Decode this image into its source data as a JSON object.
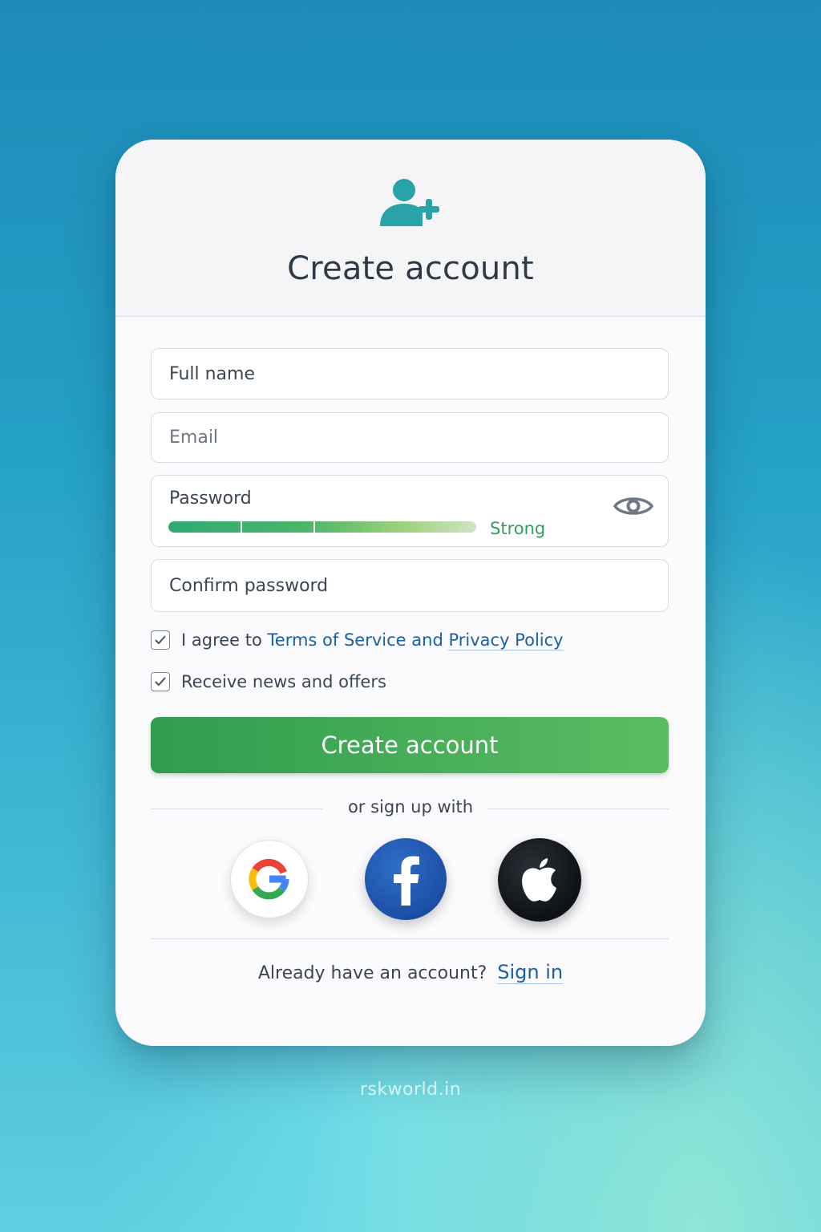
{
  "header": {
    "title": "Create account",
    "icon": "user-plus-icon"
  },
  "form": {
    "full_name_placeholder": "Full name",
    "email_placeholder": "Email",
    "password_placeholder": "Password",
    "password_strength": {
      "label": "Strong",
      "level": 0.75,
      "color": "#2f9f5e"
    },
    "confirm_password_placeholder": "Confirm password",
    "terms": {
      "checked": true,
      "prefix": "I agree to",
      "tos_link": "Terms of Service",
      "and_text": "and",
      "privacy_link": "Privacy Policy"
    },
    "newsletter": {
      "checked": true,
      "label": "Receive news and offers"
    },
    "submit_label": "Create account"
  },
  "social": {
    "divider_text": "or sign up with",
    "providers": [
      "google-icon",
      "facebook-icon",
      "apple-icon"
    ]
  },
  "footer": {
    "prompt": "Already have an account?",
    "sign_in_label": "Sign in"
  },
  "watermark": "rskworld.in",
  "colors": {
    "accent": "#2aa3a8",
    "primary_button": "#46ad58",
    "link": "#1b5fa6",
    "facebook": "#1d4fa6",
    "apple": "#0e1216"
  }
}
